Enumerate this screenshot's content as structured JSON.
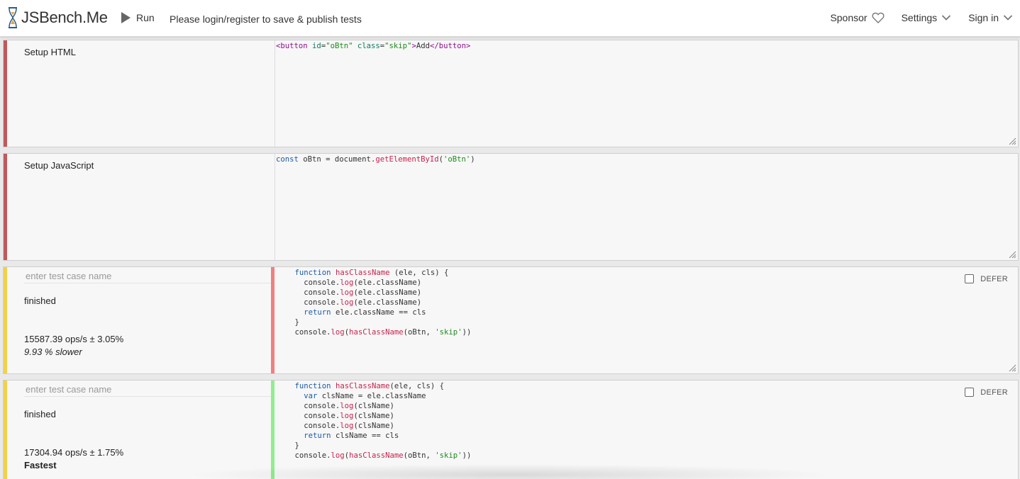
{
  "header": {
    "logo_text": "JSBench.Me",
    "run_label": "Run",
    "login_message": "Please login/register to save & publish tests",
    "sponsor_label": "Sponsor",
    "settings_label": "Settings",
    "signin_label": "Sign in"
  },
  "setup_html": {
    "label": "Setup HTML",
    "code": "<button id=\"oBtn\" class=\"skip\">Add</button>"
  },
  "setup_js": {
    "label": "Setup JavaScript",
    "code": "const oBtn = document.getElementById('oBtn')"
  },
  "test_cases": [
    {
      "name_placeholder": "enter test case name",
      "status": "finished",
      "ops": "15587.39 ops/s ± 3.05%",
      "comparison": "9.93 % slower",
      "defer_label": "DEFER",
      "code_lines": [
        "    function hasClassName (ele, cls) {",
        "      console.log(ele.className)",
        "      console.log(ele.className)",
        "      console.log(ele.className)",
        "      return ele.className == cls",
        "    }",
        "    console.log(hasClassName(oBtn, 'skip'))"
      ]
    },
    {
      "name_placeholder": "enter test case name",
      "status": "finished",
      "ops": "17304.94 ops/s ± 1.75%",
      "comparison": "Fastest",
      "defer_label": "DEFER",
      "code_lines": [
        "    function hasClassName(ele, cls) {",
        "      var clsName = ele.className",
        "      console.log(clsName)",
        "      console.log(clsName)",
        "      console.log(clsName)",
        "      return clsName == cls",
        "    }",
        "    console.log(hasClassName(oBtn, 'skip'))"
      ]
    }
  ],
  "colors": {
    "setup_stripe": "#c0595b",
    "test_stripe": "#f2d04b",
    "slower_stripe": "#f08080",
    "fastest_stripe": "#90ee90"
  }
}
